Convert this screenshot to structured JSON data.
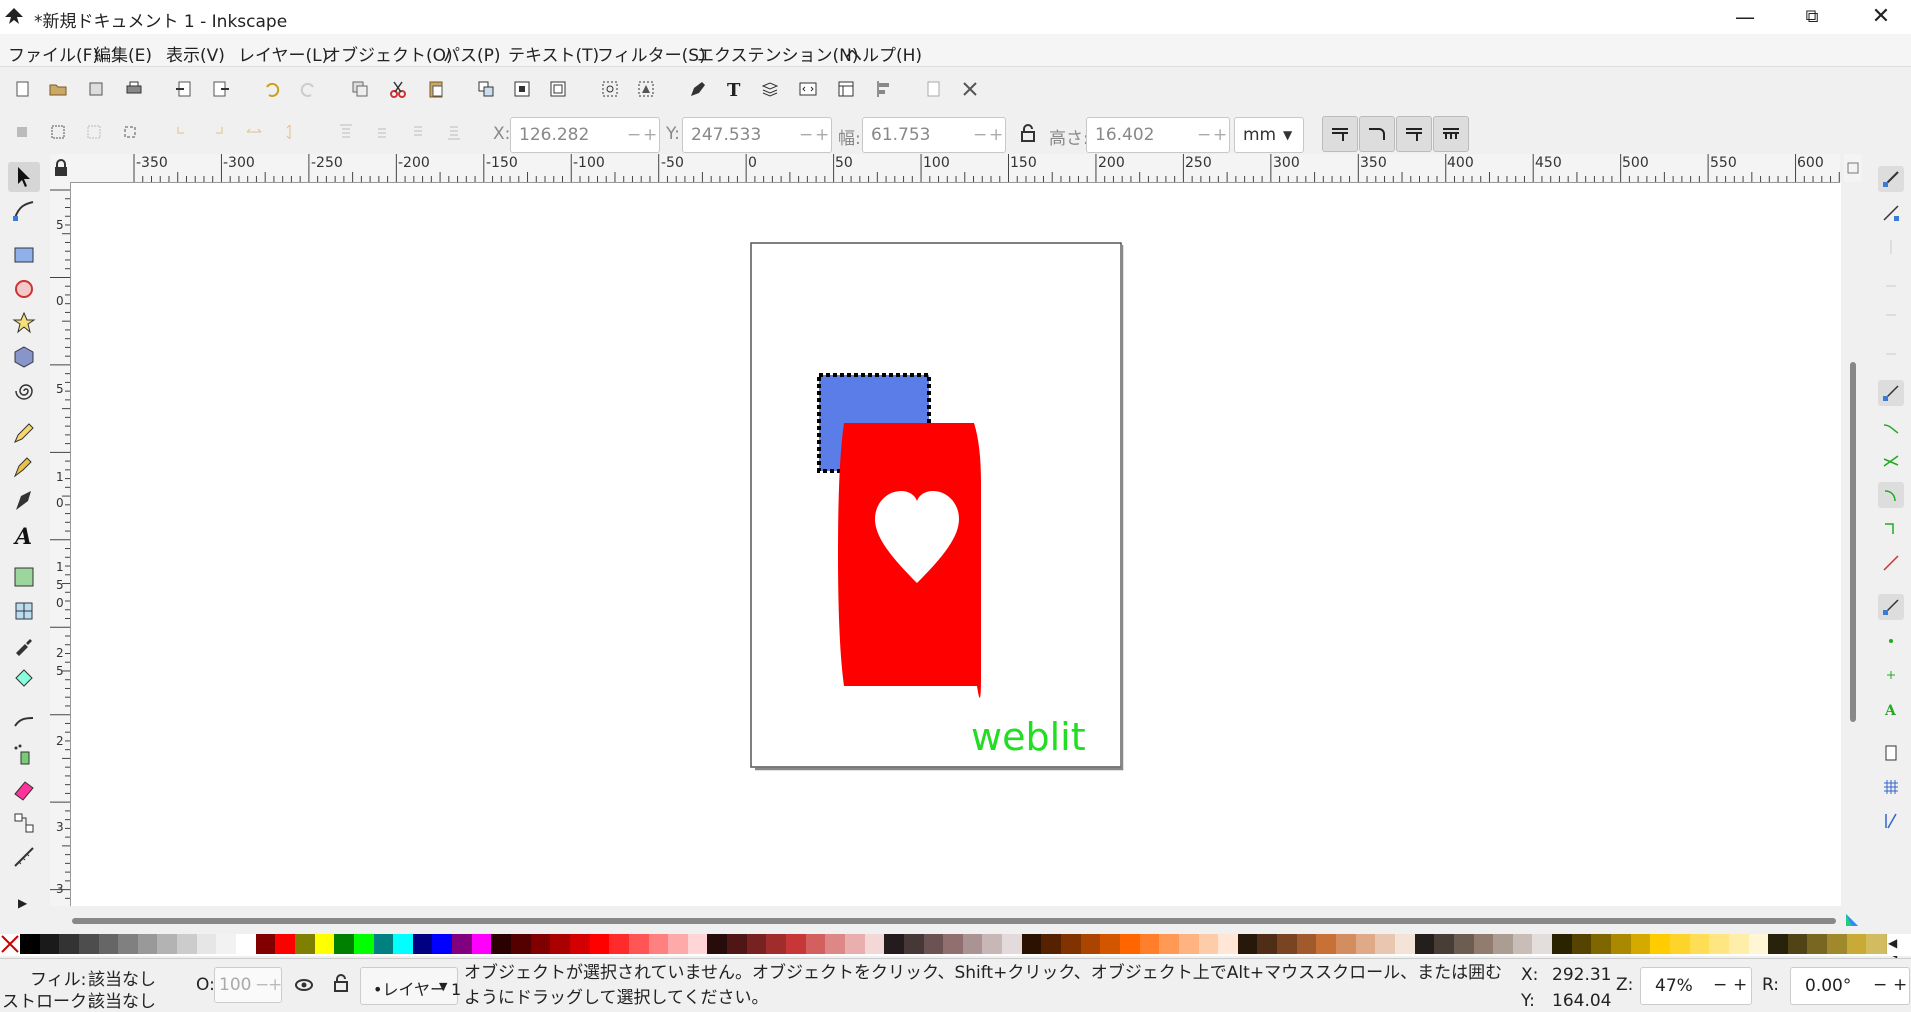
{
  "window": {
    "title": "*新規ドキュメント 1 - Inkscape"
  },
  "menu": [
    "ファイル(F)",
    "編集(E)",
    "表示(V)",
    "レイヤー(L)",
    "オブジェクト(O)",
    "パス(P)",
    "テキスト(T)",
    "フィルター(S)",
    "エクステンション(N)",
    "ヘルプ(H)"
  ],
  "controls": {
    "x_label": "X:",
    "x_value": "126.282",
    "y_label": "Y:",
    "y_value": "247.533",
    "w_label": "幅:",
    "w_value": "61.753",
    "h_label": "高さ:",
    "h_value": "16.402",
    "unit": "mm"
  },
  "ruler": {
    "h_ticks": [
      "-350",
      "-300",
      "-250",
      "-200",
      "-150",
      "-100",
      "-50",
      "0",
      "50",
      "100",
      "150",
      "200",
      "250",
      "300",
      "350",
      "400",
      "450",
      "500",
      "550",
      "600"
    ],
    "v_ticks": [
      "5",
      "0",
      "5",
      "1",
      "0",
      "1",
      "5",
      "0",
      "2",
      "5",
      "2",
      "3",
      "3"
    ]
  },
  "canvas": {
    "text": "weblit",
    "colors": {
      "rect": "#5b7de8",
      "doc": "#ff0000",
      "heart": "#ffffff",
      "text": "#22dd22"
    }
  },
  "palette": [
    "#000000",
    "#1a1a1a",
    "#333333",
    "#4d4d4d",
    "#666666",
    "#808080",
    "#999999",
    "#b3b3b3",
    "#cccccc",
    "#e6e6e6",
    "#f2f2f2",
    "#ffffff",
    "#800000",
    "#ff0000",
    "#808000",
    "#ffff00",
    "#008000",
    "#00ff00",
    "#008080",
    "#00ffff",
    "#000080",
    "#0000ff",
    "#800080",
    "#ff00ff",
    "#2b0000",
    "#550000",
    "#800000",
    "#aa0000",
    "#d40000",
    "#ff0000",
    "#ff2a2a",
    "#ff5555",
    "#ff8080",
    "#ffaaaa",
    "#ffd5d5",
    "#280b0b",
    "#501616",
    "#782121",
    "#a02c2c",
    "#c83737",
    "#d35f5f",
    "#de8787",
    "#e9afaf",
    "#f4d7d7",
    "#241c1c",
    "#483737",
    "#6c5353",
    "#916f6f",
    "#ac9393",
    "#c8b7b7",
    "#e3dbdb",
    "#2b1100",
    "#552200",
    "#803300",
    "#aa4400",
    "#d45500",
    "#ff6600",
    "#ff7f2a",
    "#ff9955",
    "#ffb380",
    "#ffccaa",
    "#ffe6d5",
    "#28170b",
    "#502d16",
    "#784421",
    "#a05a2c",
    "#c87137",
    "#d38d5f",
    "#deaa87",
    "#e9c6af",
    "#f4e3d7",
    "#241f1c",
    "#483e37",
    "#6c5d53",
    "#917c6f",
    "#ac9d93",
    "#c8beb7",
    "#e3dedb",
    "#2b2200",
    "#554400",
    "#806600",
    "#aa8800",
    "#d4aa00",
    "#ffcc00",
    "#ffd42a",
    "#ffdd55",
    "#ffe680",
    "#ffeeaa",
    "#fff6d5",
    "#28220b",
    "#504416",
    "#786721",
    "#a0892c",
    "#c8ab37",
    "#d3bc5f"
  ],
  "status": {
    "fill_label": "フィル:",
    "fill_value": "該当なし",
    "stroke_label": "ストローク:",
    "stroke_value": "該当なし",
    "opacity_label": "O:",
    "opacity_value": "100",
    "layer": "•レイヤー 1",
    "message": "オブジェクトが選択されていません。オブジェクトをクリック、Shift+クリック、オブジェクト上でAlt+マウススクロール、または囲むようにドラッグして選択してください。",
    "cursor_x_label": "X:",
    "cursor_x": "292.31",
    "cursor_y_label": "Y:",
    "cursor_y": "164.04",
    "zoom_label": "Z:",
    "zoom": "47%",
    "rotate_label": "R:",
    "rotate": "0.00°"
  }
}
